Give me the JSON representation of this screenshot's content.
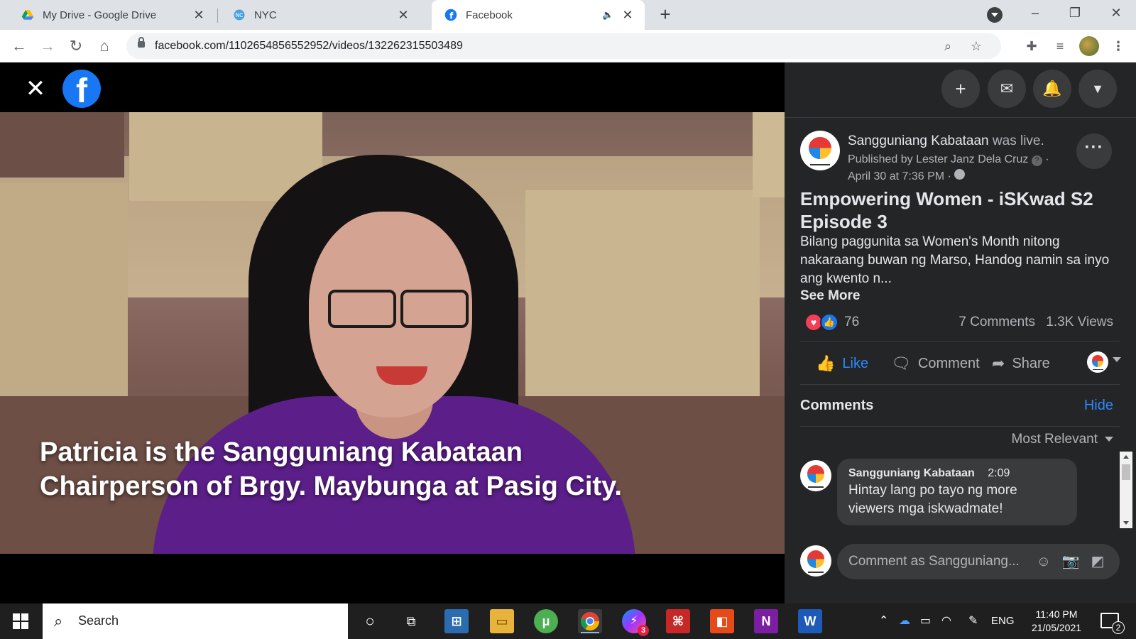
{
  "browser": {
    "tabs": [
      {
        "title": "My Drive - Google Drive",
        "icon": "google-drive-icon",
        "active": false
      },
      {
        "title": "NYC",
        "icon": "nyc-icon",
        "active": false
      },
      {
        "title": "Facebook",
        "icon": "facebook-icon",
        "active": true
      }
    ],
    "url": "facebook.com/1102654856552952/videos/132262315503489"
  },
  "video": {
    "caption_line1": "Patricia is the Sangguniang Kabataan",
    "caption_line2": "Chairperson of Brgy. Maybunga at Pasig City."
  },
  "post": {
    "page_name": "Sangguniang Kabataan",
    "live_text": "was live.",
    "published_by": "Published by Lester Janz Dela Cruz",
    "date": "April 30 at 7:36 PM ·",
    "title": "Empowering Women - iSKwad S2 Episode 3",
    "description": "Bilang paggunita sa Women's Month nitong nakaraang buwan ng Marso, Handog namin sa inyo ang kwento n...",
    "see_more": "See More",
    "reaction_count": "76",
    "comments_count": "7 Comments",
    "views_count": "1.3K Views"
  },
  "actions": {
    "like": "Like",
    "comment": "Comment",
    "share": "Share"
  },
  "comments": {
    "header": "Comments",
    "hide": "Hide",
    "sort": "Most Relevant",
    "items": [
      {
        "author": "Sangguniang Kabataan",
        "time": "2:09",
        "text": "Hintay lang po tayo ng more viewers mga iskwadmate!"
      }
    ],
    "input_placeholder": "Comment as Sangguniang..."
  },
  "taskbar": {
    "search_placeholder": "Search",
    "language": "ENG",
    "time": "11:40 PM",
    "date": "21/05/2021",
    "notification_count": "2",
    "messenger_badge": "3"
  },
  "colors": {
    "facebook_blue": "#1877f2",
    "link_blue": "#2d88ff",
    "panel_bg": "#242526",
    "bubble_bg": "#3a3b3c"
  }
}
